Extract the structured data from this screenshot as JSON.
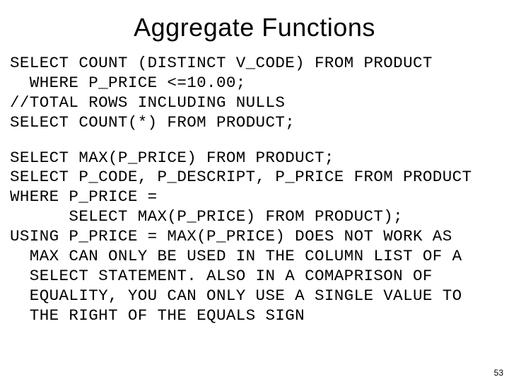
{
  "title": "Aggregate Functions",
  "block1": "SELECT COUNT (DISTINCT V_CODE) FROM PRODUCT\n  WHERE P_PRICE <=10.00;\n//TOTAL ROWS INCLUDING NULLS\nSELECT COUNT(*) FROM PRODUCT;",
  "block2": "SELECT MAX(P_PRICE) FROM PRODUCT;\nSELECT P_CODE, P_DESCRIPT, P_PRICE FROM PRODUCT\nWHERE P_PRICE =\n      SELECT MAX(P_PRICE) FROM PRODUCT);\nUSING P_PRICE = MAX(P_PRICE) DOES NOT WORK AS\n  MAX CAN ONLY BE USED IN THE COLUMN LIST OF A\n  SELECT STATEMENT. ALSO IN A COMAPRISON OF\n  EQUALITY, YOU CAN ONLY USE A SINGLE VALUE TO\n  THE RIGHT OF THE EQUALS SIGN",
  "page_number": "53"
}
